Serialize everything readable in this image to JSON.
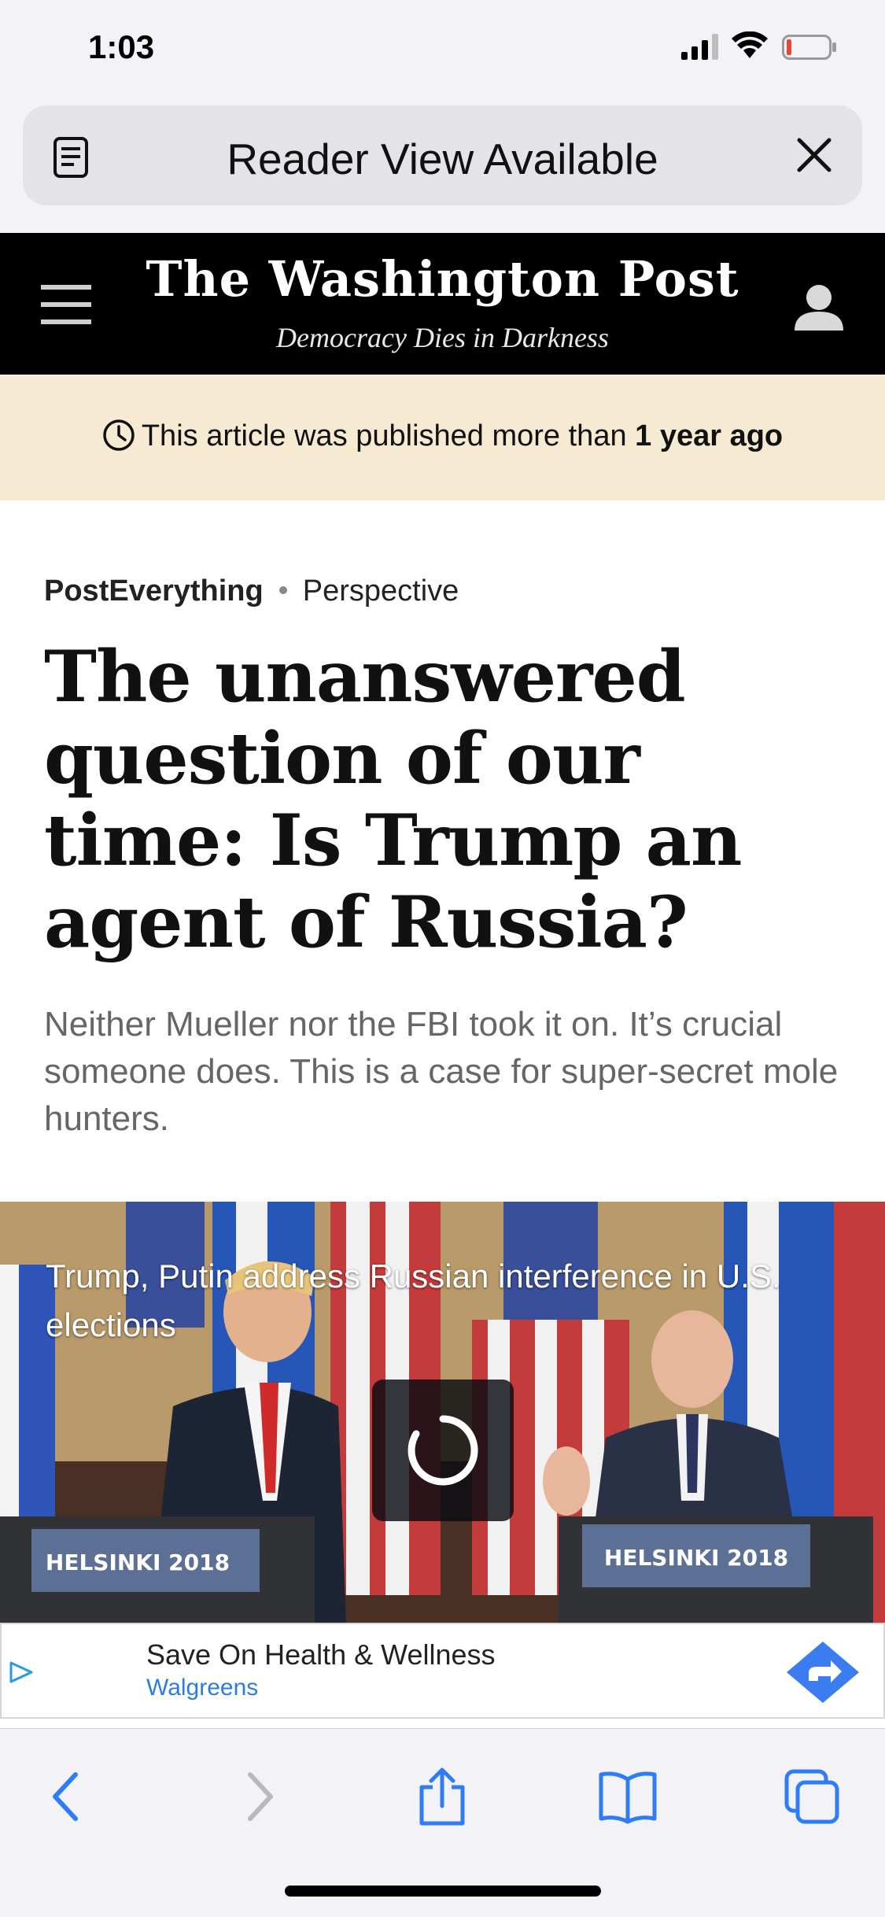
{
  "status_bar": {
    "time": "1:03"
  },
  "reader_bar": {
    "text": "Reader View Available",
    "icon": "reader-icon",
    "close_icon": "close-icon"
  },
  "masthead": {
    "logo": "The Washington Post",
    "tagline": "Democracy Dies in Darkness",
    "menu_icon": "hamburger-menu-icon",
    "account_icon": "user-icon"
  },
  "notice": {
    "prefix": "This article was published more than ",
    "emphasis": "1 year ago",
    "icon": "clock-icon"
  },
  "article": {
    "section": "PostEverything",
    "label": "Perspective",
    "headline": "The unanswered question of our time: Is Trump an agent of Russia?",
    "dek": "Neither Mueller nor the FBI took it on. It’s crucial someone does. This is a case for super-secret mole hunters."
  },
  "video": {
    "caption": "Trump, Putin address Russian interference in U.S. elections",
    "podium_left": "HELSINKI 2018",
    "podium_right": "HELSINKI 2018",
    "state": "loading"
  },
  "ad": {
    "title": "Save On Health & Wellness",
    "brand": "Walgreens",
    "choice_icon": "ad-choices-icon",
    "action_icon": "directions-arrow-icon"
  },
  "toolbar": {
    "items": [
      "back-icon",
      "forward-icon",
      "share-icon",
      "bookmarks-icon",
      "tabs-icon"
    ]
  },
  "colors": {
    "masthead_bg": "#000000",
    "notice_bg": "#f6ead2",
    "ios_blue": "#2f7cf6",
    "ad_link": "#2a7de1",
    "battery_low": "#e5483b"
  }
}
